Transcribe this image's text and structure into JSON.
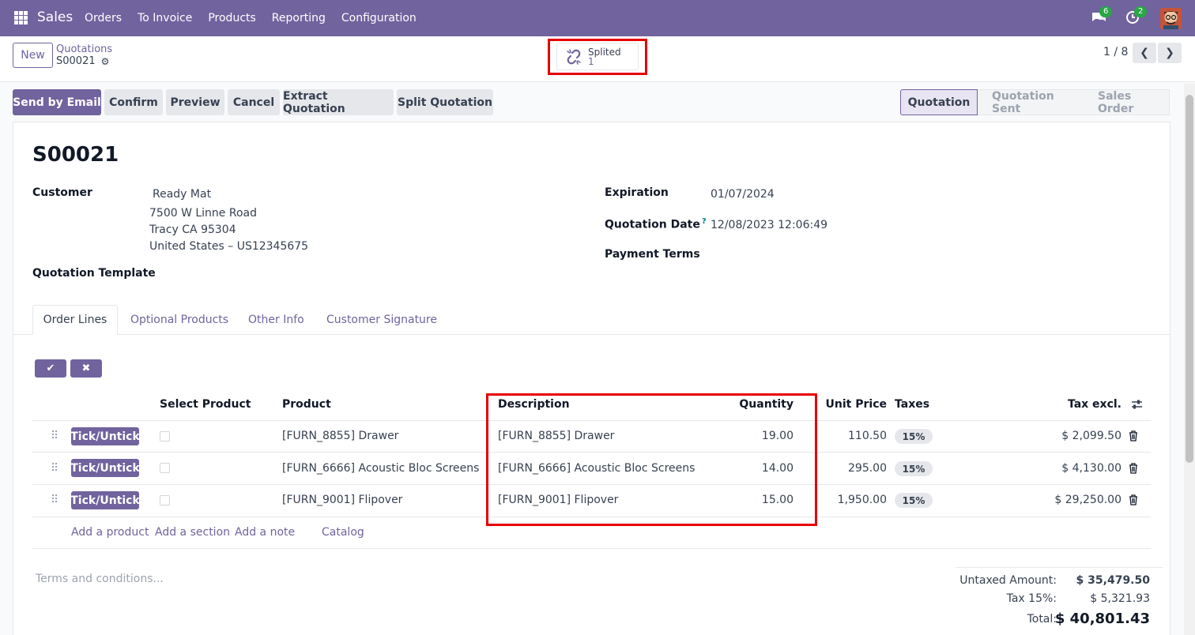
{
  "navbar": {
    "app_name": "Sales",
    "menu": [
      "Orders",
      "To Invoice",
      "Products",
      "Reporting",
      "Configuration"
    ],
    "chat_count": "6",
    "activity_count": "2"
  },
  "control_panel": {
    "new_label": "New",
    "breadcrumb": "Quotations",
    "record_name": "S00021",
    "smart_button": {
      "label": "Splited",
      "value": "1"
    },
    "pager": "1 / 8"
  },
  "actions": [
    "Send by Email",
    "Confirm",
    "Preview",
    "Cancel",
    "Extract Quotation",
    "Split Quotation"
  ],
  "statusbar": [
    "Quotation",
    "Quotation Sent",
    "Sales Order"
  ],
  "form": {
    "title": "S00021",
    "customer_label": "Customer",
    "customer_name": "Ready Mat",
    "address_1": "7500 W Linne Road",
    "address_2": "Tracy CA 95304",
    "address_3": "United States – US12345675",
    "template_label": "Quotation Template",
    "expiration_label": "Expiration",
    "expiration_value": "01/07/2024",
    "quote_date_label": "Quotation Date",
    "quote_date_help": "?",
    "quote_date_value": "12/08/2023 12:06:49",
    "payment_terms_label": "Payment Terms"
  },
  "tabs": [
    "Order Lines",
    "Optional Products",
    "Other Info",
    "Customer Signature"
  ],
  "table": {
    "headers": {
      "select": "Select Product",
      "product": "Product",
      "description": "Description",
      "quantity": "Quantity",
      "unit_price": "Unit Price",
      "taxes": "Taxes",
      "tax_excl": "Tax excl."
    },
    "tick_label": "Tick/Untick",
    "rows": [
      {
        "product": "[FURN_8855] Drawer",
        "description": "[FURN_8855] Drawer",
        "quantity": "19.00",
        "unit_price": "110.50",
        "tax": "15%",
        "subtotal": "$ 2,099.50"
      },
      {
        "product": "[FURN_6666] Acoustic Bloc Screens",
        "description": "[FURN_6666] Acoustic Bloc Screens",
        "quantity": "14.00",
        "unit_price": "295.00",
        "tax": "15%",
        "subtotal": "$ 4,130.00"
      },
      {
        "product": "[FURN_9001] Flipover",
        "description": "[FURN_9001] Flipover",
        "quantity": "15.00",
        "unit_price": "1,950.00",
        "tax": "15%",
        "subtotal": "$ 29,250.00"
      }
    ],
    "add_links": [
      "Add a product",
      "Add a section",
      "Add a note",
      "Catalog"
    ]
  },
  "terms_placeholder": "Terms and conditions...",
  "totals": {
    "untaxed_label": "Untaxed Amount:",
    "untaxed_value": "$ 35,479.50",
    "tax_label": "Tax 15%:",
    "tax_value": "$ 5,321.93",
    "total_label": "Total:",
    "total_value": "$ 40,801.43"
  },
  "colors": {
    "brand": "#71639e",
    "highlight": "#e60000",
    "badge": "#28a745"
  },
  "icons": [
    "apps-icon",
    "chat-icon",
    "activity-icon",
    "gear-icon",
    "link-split-icon",
    "chevron-left-icon",
    "chevron-right-icon",
    "check-icon",
    "close-icon",
    "drag-handle-icon",
    "trash-icon",
    "column-settings-icon"
  ]
}
